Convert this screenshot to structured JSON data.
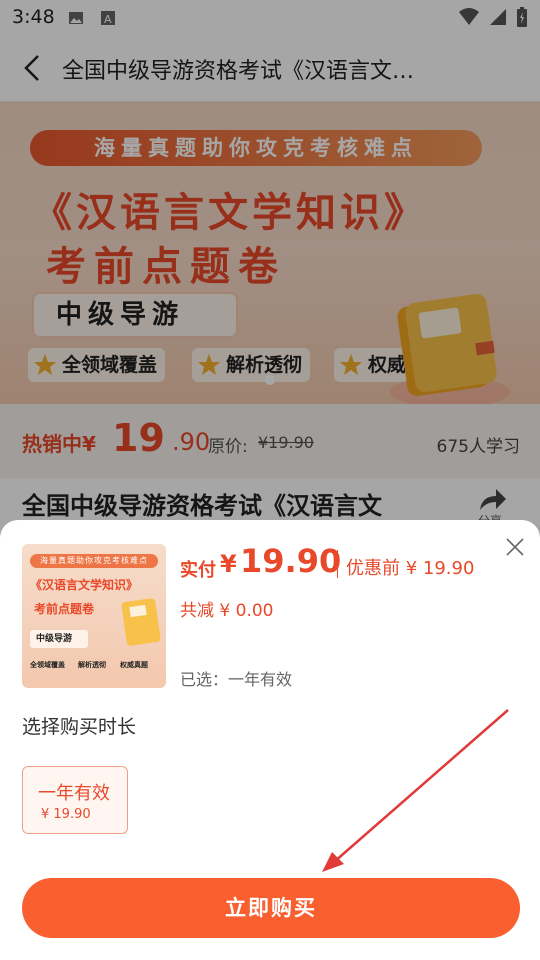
{
  "status_bar": {
    "time": "3:48"
  },
  "nav": {
    "title": "全国中级导游资格考试《汉语言文…"
  },
  "banner": {
    "slogan": "海量真题助你攻克考核难点",
    "title_line1": "《汉语言文学知识》",
    "title_line2": "考前点题卷",
    "level": "中级导游",
    "features": [
      "全领域覆盖",
      "解析透彻",
      "权威真题"
    ]
  },
  "price_row": {
    "hot_label": "热销中¥",
    "price_int": "19",
    "price_dec": ".90",
    "original_label": "原价:",
    "original_price": "¥19.90",
    "learners": "675人学习"
  },
  "course_title": "全国中级导游资格考试《汉语言文",
  "share_label": "分享",
  "sheet": {
    "thumb": {
      "slogan": "海量真题助你攻克考核难点",
      "title_line1": "《汉语言文学知识》",
      "title_line2": "考前点题卷",
      "level": "中级导游",
      "features": [
        "全领域覆盖",
        "解析透彻",
        "权威真题"
      ]
    },
    "paid_label": "实付",
    "paid_yen": "¥",
    "paid_price": "19.90",
    "before_discount": "优惠前 ¥ 19.90",
    "total_reduce": "共减 ¥ 0.00",
    "selected": "已选：一年有效",
    "duration_label": "选择购买时长",
    "duration_options": [
      {
        "name": "一年有效",
        "price": "¥ 19.90"
      }
    ],
    "buy_button": "立即购买"
  },
  "colors": {
    "accent": "#e8492a",
    "button": "#fa5f2f",
    "arrow": "#e03a3a"
  }
}
